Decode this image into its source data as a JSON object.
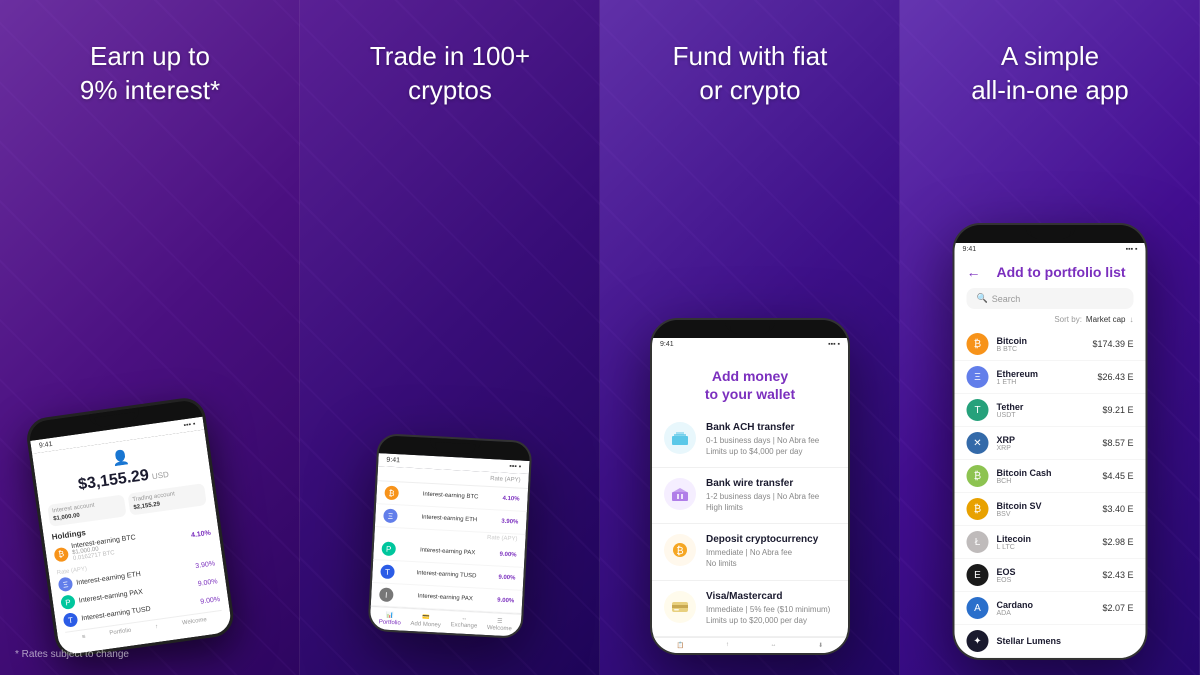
{
  "panels": {
    "panel1": {
      "title_line1": "Earn up to",
      "title_line2": "9% interest*",
      "disclaimer": "* Rates subject to change",
      "phone": {
        "time": "9:41",
        "balance": "$3,155.29",
        "balance_currency": "USD",
        "interest_account": "Interest account",
        "interest_value": "$1,000.00",
        "trading_account": "Trading account",
        "trading_value": "$2,155.29",
        "holdings_title": "Holdings",
        "holdings": [
          {
            "name": "Interest-earning BTC",
            "amount": "$1,000.00",
            "units": "0.0162717 BTC",
            "rate_label": "Rate (APY)",
            "rate": "4.10%",
            "color": "#f7931a",
            "symbol": "₿"
          },
          {
            "name": "Interest-earning ETH",
            "rate": "3.90%",
            "color": "#627eea",
            "symbol": "Ξ"
          },
          {
            "name": "Interest-earning PAX",
            "rate": "9.00%",
            "color": "#00c69d",
            "symbol": "P"
          },
          {
            "name": "Interest-earning TUSD",
            "rate": "9.00%",
            "color": "#2b5ce6",
            "symbol": "T"
          }
        ]
      }
    },
    "panel2": {
      "title_line1": "Trade in 100+",
      "title_line2": "cryptos",
      "phone": {
        "time": "9:41",
        "column_header": "Rate (APY)",
        "rows": [
          {
            "name": "Interest-earning BTC",
            "rate": "4.10%"
          },
          {
            "name": "Interest-earning ETH",
            "rate": "3.90%"
          },
          {
            "name": "Interest-earning PAX",
            "rate": "9.00%"
          },
          {
            "name": "Interest-earning TUSD",
            "rate": "9.00%"
          }
        ],
        "nav": [
          "Portfolio",
          "Add Money",
          "Exchange",
          "Welcome"
        ]
      }
    },
    "panel3": {
      "title_line1": "Fund with fiat",
      "title_line2": "or crypto",
      "phone": {
        "time": "9:41",
        "screen_title_line1": "Add money",
        "screen_title_line2": "to your wallet",
        "payment_options": [
          {
            "name": "Bank ACH transfer",
            "icon": "🏦",
            "icon_color": "#5bc8e8",
            "detail_line1": "0-1 business days | No Abra fee",
            "detail_line2": "Limits up to $4,000 per day"
          },
          {
            "name": "Bank wire transfer",
            "icon": "🏛",
            "icon_color": "#b07ee8",
            "detail_line1": "1-2 business days | No Abra fee",
            "detail_line2": "High limits"
          },
          {
            "name": "Deposit cryptocurrency",
            "icon": "💰",
            "icon_color": "#f5a623",
            "detail_line1": "Immediate | No Abra fee",
            "detail_line2": "No limits"
          },
          {
            "name": "Visa/Mastercard",
            "icon": "💳",
            "icon_color": "#e8d07e",
            "detail_line1": "Immediate | 5% fee ($10 minimum)",
            "detail_line2": "Limits up to $20,000 per day"
          }
        ]
      }
    },
    "panel4": {
      "title_line1": "A simple",
      "title_line2": "all-in-one app",
      "phone": {
        "time": "9:41",
        "back_label": "←",
        "screen_title": "Add to portfolio list",
        "search_placeholder": "Search",
        "sort_by_label": "Sort by:",
        "sort_by_value": "Market cap",
        "coins": [
          {
            "name": "Bitcoin",
            "ticker": "B BTC",
            "price": "$174.39 E",
            "color": "#f7931a",
            "symbol": "₿"
          },
          {
            "name": "Ethereum",
            "ticker": "1 ETH",
            "price": "$26.43 E",
            "color": "#627eea",
            "symbol": "Ξ"
          },
          {
            "name": "Tether",
            "ticker": "USDT",
            "price": "$9.21 E",
            "color": "#26a17b",
            "symbol": "T"
          },
          {
            "name": "XRP",
            "ticker": "XRP",
            "price": "$8.57 E",
            "color": "#346aa9",
            "symbol": "✕"
          },
          {
            "name": "Bitcoin Cash",
            "ticker": "BCH",
            "price": "$4.45 E",
            "color": "#8dc351",
            "symbol": "₿"
          },
          {
            "name": "Bitcoin SV",
            "ticker": "BSV",
            "price": "$3.40 E",
            "color": "#e8a100",
            "symbol": "₿"
          },
          {
            "name": "Litecoin",
            "ticker": "L LTC",
            "price": "$2.98 E",
            "color": "#bfbbbb",
            "symbol": "Ł"
          },
          {
            "name": "EOS",
            "ticker": "EOS",
            "price": "$2.43 E",
            "color": "#1a1a1a",
            "symbol": "E"
          },
          {
            "name": "Cardano",
            "ticker": "ADA",
            "price": "$2.07 E",
            "color": "#2a6fcb",
            "symbol": "A"
          },
          {
            "name": "Stellar Lumens",
            "ticker": "",
            "price": "",
            "color": "#1a1a2e",
            "symbol": "✦"
          }
        ]
      }
    }
  }
}
